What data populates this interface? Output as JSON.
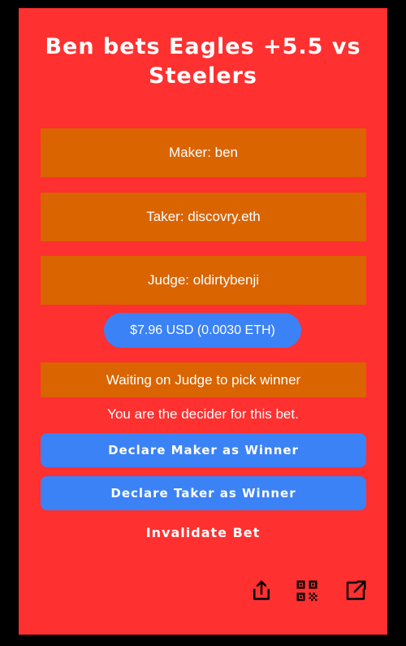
{
  "title": "Ben bets Eagles +5.5 vs Steelers",
  "maker": "Maker: ben",
  "taker": "Taker: discovry.eth",
  "judge": "Judge: oldirtybenji",
  "amount": "$7.96 USD (0.0030 ETH)",
  "status": "Waiting on Judge to pick winner",
  "decider_note": "You are the decider for this bet.",
  "buttons": {
    "declare_maker": "Declare Maker as Winner",
    "declare_taker": "Declare Taker as Winner",
    "invalidate": "Invalidate Bet"
  },
  "icons": [
    "share-icon",
    "qr-code-icon",
    "open-external-icon"
  ],
  "colors": {
    "page_background": "#000000",
    "card_background": "#ff3030",
    "info_box": "#d96400",
    "accent_blue": "#3b82f6",
    "text": "#ffffff"
  }
}
